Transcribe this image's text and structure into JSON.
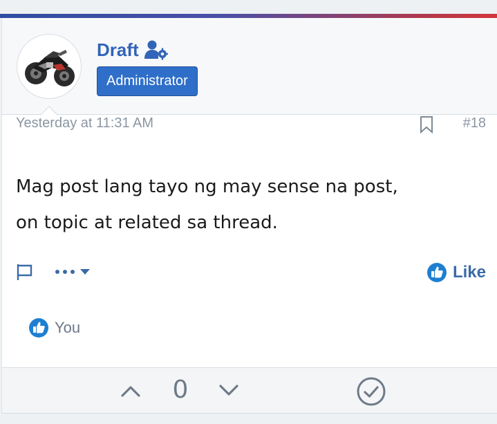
{
  "post": {
    "author": {
      "name": "Draft",
      "role": "Administrator",
      "avatar_icon": "motorcycle-icon",
      "badge_icon": "user-cog-icon"
    },
    "date": "Yesterday at 11:31 AM",
    "post_number": "#18",
    "message_lines": [
      "Mag post lang tayo ng may sense na post,",
      "on topic at related sa thread."
    ],
    "actions": {
      "report_icon": "flag-icon",
      "more_icon": "more-dots-icon",
      "like_label": "Like"
    },
    "reactions": {
      "icon": "thumbs-up-icon",
      "summary": "You"
    },
    "votes": {
      "count": "0",
      "upvote_icon": "chevron-up-icon",
      "downvote_icon": "chevron-down-icon",
      "solution_icon": "check-circle-icon"
    }
  },
  "colors": {
    "accent": "#3264b8",
    "badge_bg": "#2f6fc9",
    "meta_text": "#8a96a3",
    "like_text": "#3b6aa8",
    "reaction_blue": "#1e7fd0"
  }
}
